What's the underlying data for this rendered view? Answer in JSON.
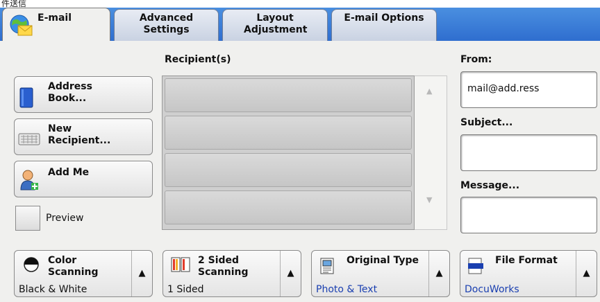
{
  "top_fragment": "件送信",
  "tabs": [
    {
      "label": "E-mail",
      "active": true
    },
    {
      "label": "Advanced Settings"
    },
    {
      "label": "Layout Adjustment"
    },
    {
      "label": "E-mail Options"
    }
  ],
  "recipients_label": "Recipient(s)",
  "from_label": "From:",
  "from_value": "mail@add.ress",
  "subject_label": "Subject...",
  "message_label": "Message...",
  "address_book": "Address Book...",
  "new_recipient": "New Recipient...",
  "add_me": "Add Me",
  "preview": "Preview",
  "scroll_up": "▲",
  "scroll_down": "▼",
  "features": [
    {
      "title": "Color Scanning",
      "value": "Black & White"
    },
    {
      "title": "2 Sided Scanning",
      "value": "1 Sided"
    },
    {
      "title": "Original Type",
      "value": "Photo & Text"
    },
    {
      "title": "File Format",
      "value": "DocuWorks"
    }
  ],
  "feature_arrow": "▲",
  "colors": {
    "tab_bar": "#3a7fd8",
    "panel": "#f0f0ee",
    "value_blue": "#1a3fb0"
  },
  "icons": [
    "globe-mail-icon",
    "address-book-icon",
    "keyboard-icon",
    "person-add-icon",
    "color-scanning-icon",
    "duplex-icon",
    "original-type-icon",
    "docuworks-icon"
  ]
}
